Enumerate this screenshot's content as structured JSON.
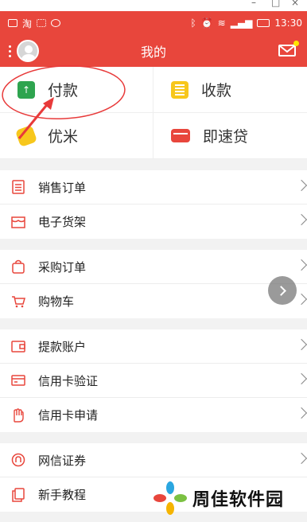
{
  "status_bar": {
    "time": "13:30",
    "left_icons": [
      "image-icon",
      "taobao-icon",
      "grid-icon",
      "minus-circle-icon"
    ],
    "right_icons": [
      "bluetooth-icon",
      "alarm-icon",
      "wifi-icon",
      "signal-icon",
      "battery-icon"
    ]
  },
  "header": {
    "title": "我的",
    "menu_icon": "dots-vertical-icon",
    "avatar": "avatar",
    "mail_icon": "mail-icon",
    "mail_badge_color": "#ffe600"
  },
  "quick_grid": [
    {
      "label": "付款",
      "icon": "payment-icon"
    },
    {
      "label": "收款",
      "icon": "receive-icon"
    },
    {
      "label": "优米",
      "icon": "youmi-icon"
    },
    {
      "label": "即速贷",
      "icon": "loan-card-icon"
    }
  ],
  "sections": [
    {
      "items": [
        {
          "label": "销售订单",
          "icon": "order-list-icon"
        },
        {
          "label": "电子货架",
          "icon": "shelf-icon"
        }
      ]
    },
    {
      "items": [
        {
          "label": "采购订单",
          "icon": "shopping-bag-icon"
        },
        {
          "label": "购物车",
          "icon": "cart-icon"
        }
      ]
    },
    {
      "items": [
        {
          "label": "提款账户",
          "icon": "wallet-icon"
        },
        {
          "label": "信用卡验证",
          "icon": "credit-card-icon"
        },
        {
          "label": "信用卡申请",
          "icon": "hand-icon"
        }
      ]
    },
    {
      "items": [
        {
          "label": "网信证券",
          "icon": "securities-icon"
        },
        {
          "label": "新手教程",
          "icon": "tutorial-icon"
        }
      ]
    }
  ],
  "watermark": {
    "text": "周佳软件园"
  },
  "colors": {
    "accent": "#e8463c",
    "annotation": "#e83a3a"
  }
}
